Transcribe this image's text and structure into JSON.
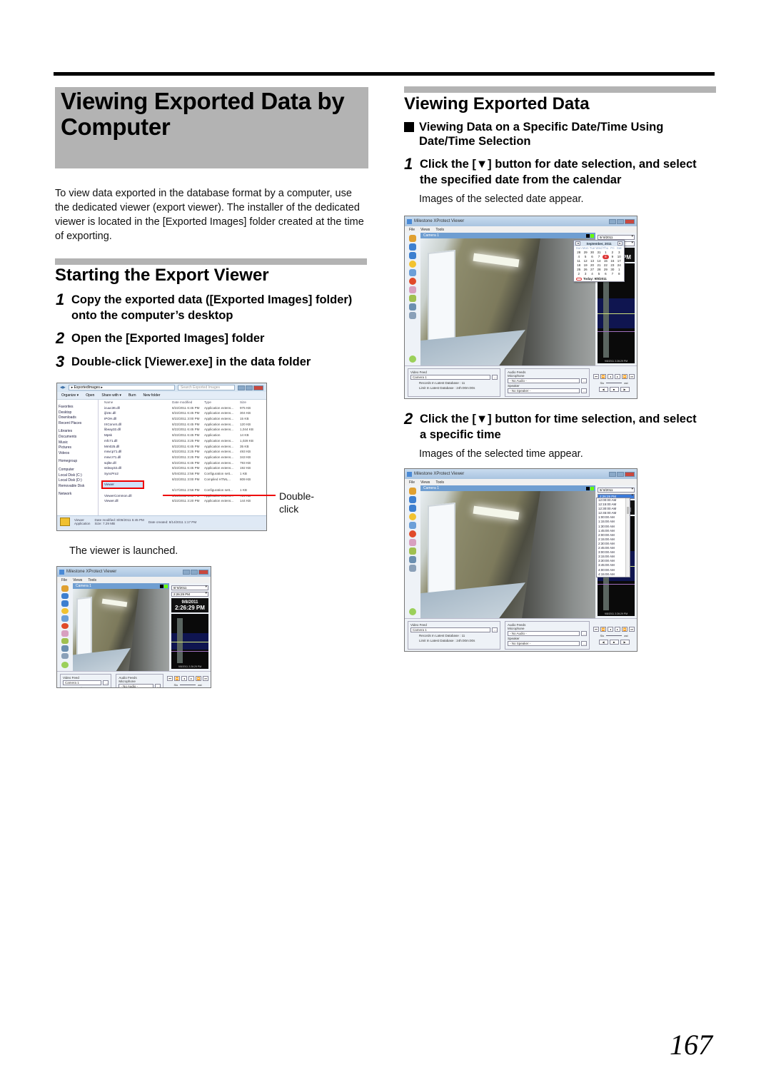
{
  "page": {
    "main_title": "Viewing Exported Data by Computer",
    "intro": "To view data exported in the database format by a computer, use the dedicated viewer (export viewer). The installer of the dedicated viewer is located in the [Exported Images] folder created at the time of exporting.",
    "page_number": "167"
  },
  "starting": {
    "title": "Starting the Export Viewer",
    "steps": [
      {
        "num": "1",
        "text": "Copy the exported data ([Exported Images] folder) onto the computer’s desktop"
      },
      {
        "num": "2",
        "text": "Open the [Exported Images] folder"
      },
      {
        "num": "3",
        "text": "Double-click [Viewer.exe] in the data folder"
      }
    ],
    "callout": "Double-click",
    "launched_note": "The viewer is launched."
  },
  "viewing": {
    "title": "Viewing Exported Data",
    "subheading": "Viewing Data on a Specific Date/Time Using Date/Time Selection",
    "steps": [
      {
        "num": "1",
        "text": "Click the [▼] button for date selection, and select the specified date from the calendar",
        "note": "Images of the selected date appear."
      },
      {
        "num": "2",
        "text": "Click the [▼] button for time selection, and select a specific time",
        "note": "Images of the selected time appear."
      }
    ]
  },
  "explorer": {
    "path": "▸ ExportedImages ▸",
    "search_placeholder": "Search Exported Images",
    "toolbar": [
      "Organize ▾",
      "Open",
      "Share with ▾",
      "Burn",
      "New folder"
    ],
    "nav": [
      {
        "label": "Favorites",
        "group": true
      },
      {
        "label": "Desktop"
      },
      {
        "label": "Downloads"
      },
      {
        "label": "Recent Places"
      },
      {
        "label": "Libraries",
        "group": true
      },
      {
        "label": "Documents"
      },
      {
        "label": "Music"
      },
      {
        "label": "Pictures"
      },
      {
        "label": "Videos"
      },
      {
        "label": "Homegroup",
        "group": true
      },
      {
        "label": "Computer",
        "group": true
      },
      {
        "label": "Local Disk (C:)"
      },
      {
        "label": "Local Disk (D:)"
      },
      {
        "label": "Removable Disk"
      },
      {
        "label": "Network",
        "group": true
      }
    ],
    "columns": [
      "Name",
      "Date modified",
      "Type",
      "Size"
    ],
    "files": [
      {
        "name": "icuuc36.dll",
        "date": "8/22/2011 6:45 PM",
        "type": "Application extens...",
        "size": "975 KB"
      },
      {
        "name": "ijl15c.dll",
        "date": "8/22/2011 6:45 PM",
        "type": "Application extens...",
        "size": "304 KB"
      },
      {
        "name": "IPOH.dll",
        "date": "8/22/2011 3:00 PM",
        "type": "Application extens...",
        "size": "15 KB"
      },
      {
        "name": "IXConvX.dll",
        "date": "8/22/2011 6:45 PM",
        "type": "Application extens...",
        "size": "120 KB"
      },
      {
        "name": "libeay32.dll",
        "date": "8/22/2011 6:45 PM",
        "type": "Application extens...",
        "size": "1,044 KB"
      },
      {
        "name": "Mpsk",
        "date": "8/22/2011 6:45 PM",
        "type": "Application",
        "size": "14 KB"
      },
      {
        "name": "mfc71.dll",
        "date": "8/22/2011 3:25 PM",
        "type": "Application extens...",
        "size": "1,028 KB"
      },
      {
        "name": "Mm025.dll",
        "date": "8/22/2011 6:45 PM",
        "type": "Application extens...",
        "size": "35 KB"
      },
      {
        "name": "msvcp71.dll",
        "date": "8/22/2011 3:25 PM",
        "type": "Application extens...",
        "size": "493 KB"
      },
      {
        "name": "msvcr71.dll",
        "date": "8/22/2011 3:25 PM",
        "type": "Application extens...",
        "size": "343 KB"
      },
      {
        "name": "sqlite.dll",
        "date": "8/22/2011 6:45 PM",
        "type": "Application extens...",
        "size": "793 KB"
      },
      {
        "name": "ssleay32.dll",
        "date": "8/22/2011 6:45 PM",
        "type": "Application extens...",
        "size": "192 KB"
      },
      {
        "name": "SyncPro2",
        "date": "5/04/2011 2:56 PM",
        "type": "Configuration sett...",
        "size": "1 KB"
      },
      {
        "name": "",
        "date": "8/22/2011 3:00 PM",
        "type": "Compiled HTML...",
        "size": "809 KB"
      },
      {
        "name": "Viewer",
        "date": "",
        "type": "",
        "size": "",
        "selected": true
      },
      {
        "name": "",
        "date": "6/17/2011 2:56 PM",
        "type": "Configuration sett...",
        "size": "1 KB"
      },
      {
        "name": "ViewerCommon.dll",
        "date": "8/22/2011 6:45 PM",
        "type": "Application extens...",
        "size": "724 KB"
      },
      {
        "name": "Viewer.dll",
        "date": "8/22/2011 3:20 PM",
        "type": "Application extens...",
        "size": "144 KB"
      }
    ],
    "status": {
      "name": "Viewer",
      "kind": "Application",
      "modified": "Date modified: 8/09/2011 5:45 PM",
      "size": "Size: 7.29 MB",
      "created": "Date created: 8/14/2011 1:17 PM"
    }
  },
  "viewer": {
    "title": "Milestone XProtect Viewer",
    "menu": [
      "File",
      "Views",
      "Tools"
    ],
    "camera": "Camera 1",
    "date_value": "9/ 8/2011",
    "time_value": "2:26:29 PM",
    "clock_date": "9/8/2011",
    "clock_time": "2:26:29 PM",
    "timeline_stamp": "9/8/2011 2:26:29 PM",
    "video_feed_label": "Video Feed",
    "video_feed_value": "Camera 1",
    "records_label": "Records In Latest Database :",
    "records_value": "11",
    "limit_label": "Limit In Latest Database :",
    "limit_value": "24h:00m:00s",
    "audio_label": "Audio Feeds",
    "microphone_label": "Microphone",
    "microphone_value": "- No Audio -",
    "speaker_label": "Speaker",
    "speaker_value": "- No Speaker -",
    "slow_label": "Slo",
    "fast_label": "ast",
    "more_button": "..."
  },
  "calendar": {
    "month": "September, 2011",
    "days_header": [
      "Sun",
      "Mon",
      "Tue",
      "Wed",
      "Thu",
      "Fri",
      "Sat"
    ],
    "days": [
      "28",
      "29",
      "30",
      "31",
      "1",
      "2",
      "3",
      "4",
      "5",
      "6",
      "7",
      "8",
      "9",
      "10",
      "11",
      "12",
      "13",
      "14",
      "15",
      "16",
      "17",
      "18",
      "19",
      "20",
      "21",
      "22",
      "23",
      "24",
      "25",
      "26",
      "27",
      "28",
      "29",
      "30",
      "1",
      "2",
      "3",
      "4",
      "5",
      "6",
      "7",
      "8"
    ],
    "selected": "8",
    "today": "Today: 9/8/2011"
  },
  "time_list": {
    "selected_value": "2:26:29 PM",
    "items": [
      "12:00:00 AM",
      "12:15:00 AM",
      "12:30:00 AM",
      "12:45:00 AM",
      "1:00:00 AM",
      "1:15:00 AM",
      "1:30:00 AM",
      "1:45:00 AM",
      "2:00:00 AM",
      "2:15:00 AM",
      "2:30:00 AM",
      "2:45:00 AM",
      "3:00:00 AM",
      "3:15:00 AM",
      "3:30:00 AM",
      "3:45:00 AM",
      "4:00:00 AM",
      "4:15:00 AM"
    ]
  }
}
